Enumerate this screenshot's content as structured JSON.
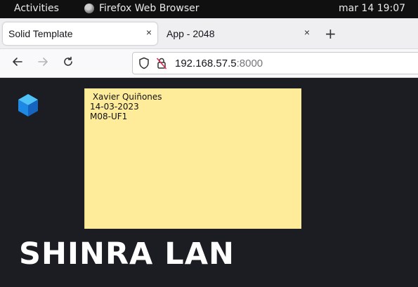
{
  "topbar": {
    "activities": "Activities",
    "app_name": "Firefox Web Browser",
    "app_icon": "firefox-icon",
    "clock": "mar 14  19:07"
  },
  "tabs": [
    {
      "label": "Solid Template",
      "active": true
    },
    {
      "label": "App - 2048",
      "active": false
    }
  ],
  "tab_close_glyph": "×",
  "new_tab_glyph": "+",
  "nav": {
    "back_icon": "back-arrow-icon",
    "forward_icon": "forward-arrow-icon",
    "reload_icon": "reload-icon"
  },
  "urlbar": {
    "host": "192.168.57.5",
    "port": ":8000"
  },
  "note": {
    "lines": [
      " Xavier Quiñones",
      "14-03-2023",
      "M08-UF1"
    ]
  },
  "page": {
    "brand": "SHINRA LAN"
  },
  "colors": {
    "page_bg": "#1c1d22",
    "sticky_bg": "#feec9b",
    "logo_blue": "#1e88e5"
  }
}
